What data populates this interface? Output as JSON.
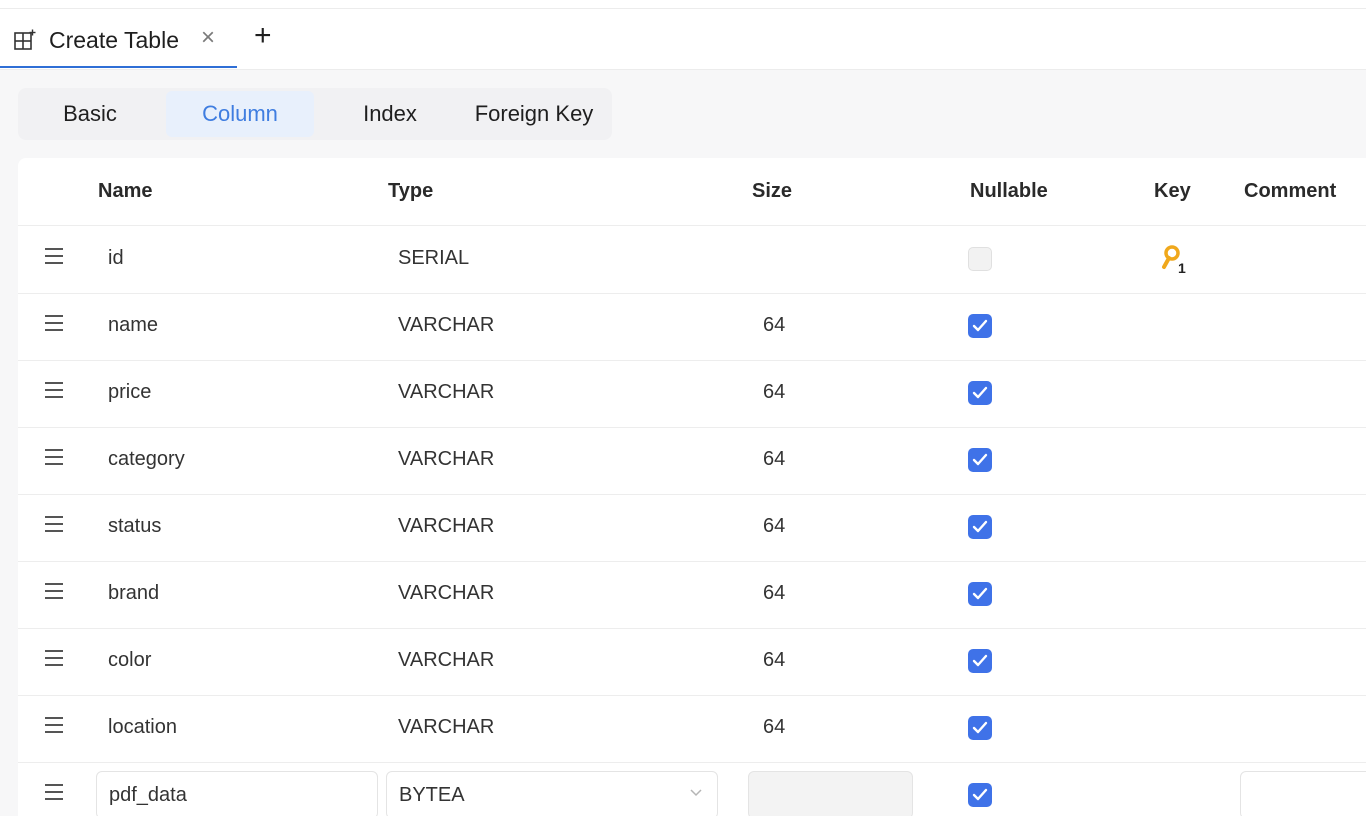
{
  "tab": {
    "title": "Create Table",
    "close_glyph": "×",
    "add_glyph": "+",
    "icon": "table-add-icon"
  },
  "subtabs": [
    {
      "label": "Basic",
      "active": false
    },
    {
      "label": "Column",
      "active": true
    },
    {
      "label": "Index",
      "active": false
    },
    {
      "label": "Foreign Key",
      "active": false
    }
  ],
  "columns": {
    "name": "Name",
    "type": "Type",
    "size": "Size",
    "nullable": "Nullable",
    "key": "Key",
    "comment": "Comment"
  },
  "rows": [
    {
      "name": "id",
      "type": "SERIAL",
      "size": "",
      "nullable": false,
      "key": "1"
    },
    {
      "name": "name",
      "type": "VARCHAR",
      "size": "64",
      "nullable": true,
      "key": ""
    },
    {
      "name": "price",
      "type": "VARCHAR",
      "size": "64",
      "nullable": true,
      "key": ""
    },
    {
      "name": "category",
      "type": "VARCHAR",
      "size": "64",
      "nullable": true,
      "key": ""
    },
    {
      "name": "status",
      "type": "VARCHAR",
      "size": "64",
      "nullable": true,
      "key": ""
    },
    {
      "name": "brand",
      "type": "VARCHAR",
      "size": "64",
      "nullable": true,
      "key": ""
    },
    {
      "name": "color",
      "type": "VARCHAR",
      "size": "64",
      "nullable": true,
      "key": ""
    },
    {
      "name": "location",
      "type": "VARCHAR",
      "size": "64",
      "nullable": true,
      "key": ""
    }
  ],
  "edit_row": {
    "name": "pdf_data",
    "type": "BYTEA",
    "size": "",
    "nullable": true,
    "comment": ""
  },
  "colors": {
    "accent": "#3f72e8",
    "active_tab_bg": "#e8f0fc",
    "active_tab_text": "#3f7de0",
    "key": "#f0a81c"
  }
}
